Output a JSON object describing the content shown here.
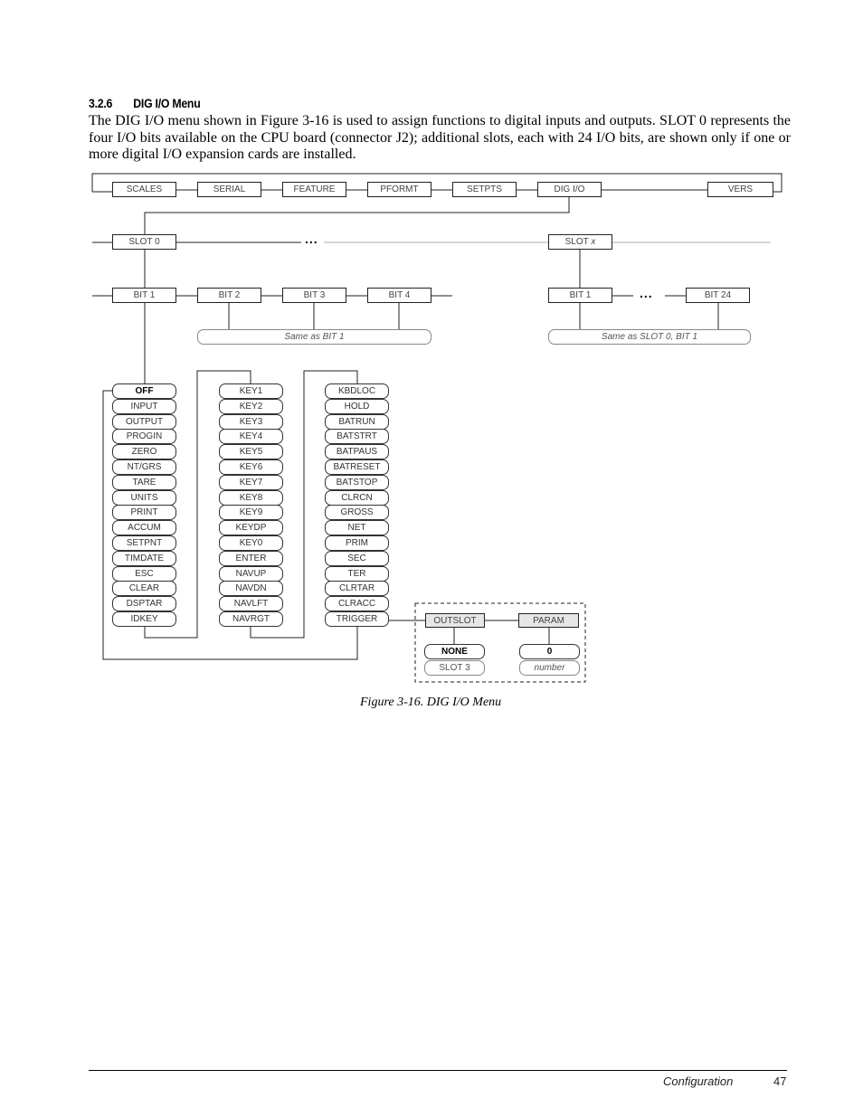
{
  "section": {
    "number": "3.2.6",
    "title": "DIG I/O Menu"
  },
  "body_text": "The DIG I/O menu shown in Figure 3-16 is used to assign functions to digital inputs and outputs. SLOT 0 represents the four I/O bits available on the CPU board (connector J2); additional slots, each with 24 I/O bits, are shown only if one or more digital I/O expansion cards are installed.",
  "diagram": {
    "top_menu": [
      "SCALES",
      "SERIAL",
      "FEATURE",
      "PFORMT",
      "SETPTS",
      "DIG I/O",
      "VERS"
    ],
    "slots": {
      "first": "SLOT 0",
      "last_prefix": "SLOT ",
      "last_var": "x",
      "ellipsis": "..."
    },
    "slot0_bits": [
      "BIT 1",
      "BIT 2",
      "BIT 3",
      "BIT 4"
    ],
    "slot0_same_as": "Same as BIT 1",
    "slotx_bits": [
      "BIT 1",
      "BIT 24"
    ],
    "slotx_same_as": "Same as SLOT 0, BIT 1",
    "function_col1": [
      "OFF",
      "INPUT",
      "OUTPUT",
      "PROGIN",
      "ZERO",
      "NT/GRS",
      "TARE",
      "UNITS",
      "PRINT",
      "ACCUM",
      "SETPNT",
      "TIMDATE",
      "ESC",
      "CLEAR",
      "DSPTAR",
      "IDKEY"
    ],
    "function_col2": [
      "KEY1",
      "KEY2",
      "KEY3",
      "KEY4",
      "KEY5",
      "KEY6",
      "KEY7",
      "KEY8",
      "KEY9",
      "KEYDP",
      "KEY0",
      "ENTER",
      "NAVUP",
      "NAVDN",
      "NAVLFT",
      "NAVRGT"
    ],
    "function_col3": [
      "KBDLOC",
      "HOLD",
      "BATRUN",
      "BATSTRT",
      "BATPAUS",
      "BATRESET",
      "BATSTOP",
      "CLRCN",
      "GROSS",
      "NET",
      "PRIM",
      "SEC",
      "TER",
      "CLRTAR",
      "CLRACC",
      "TRIGGER"
    ],
    "default_function": "OFF",
    "trigger_params": {
      "outslot": {
        "label": "OUTSLOT",
        "options": [
          "NONE",
          "SLOT 3"
        ],
        "default": "NONE"
      },
      "param": {
        "label": "PARAM",
        "options": [
          "0",
          "number"
        ],
        "default": "0"
      }
    }
  },
  "caption": "Figure 3-16. DIG I/O Menu",
  "footer": {
    "section": "Configuration",
    "page": "47"
  }
}
